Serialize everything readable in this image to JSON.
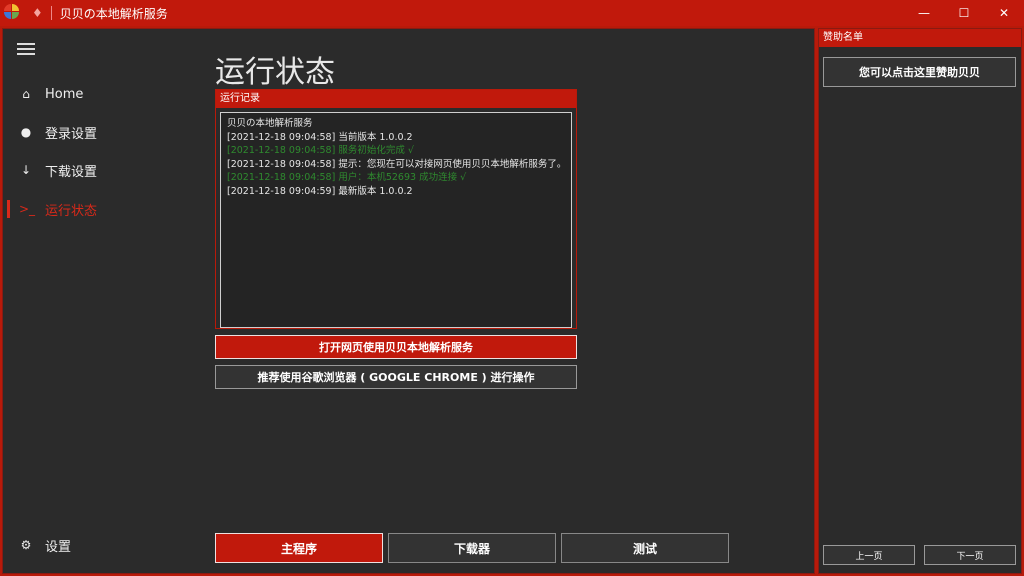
{
  "window": {
    "title": "贝贝の本地解析服务",
    "minimize": "—",
    "maximize": "☐",
    "close": "✕"
  },
  "nav": {
    "items": [
      {
        "label": "Home",
        "icon": "home-icon",
        "active": false
      },
      {
        "label": "登录设置",
        "icon": "user-icon",
        "active": false
      },
      {
        "label": "下载设置",
        "icon": "download-icon",
        "active": false
      },
      {
        "label": "运行状态",
        "icon": "terminal-icon",
        "active": true
      }
    ],
    "settings_label": "设置"
  },
  "page": {
    "title": "运行状态"
  },
  "log": {
    "header": "运行记录",
    "lines": [
      {
        "text": "贝贝の本地解析服务",
        "ok": false
      },
      {
        "text": "[2021-12-18 09:04:58] 当前版本 1.0.0.2",
        "ok": false
      },
      {
        "text": "[2021-12-18 09:04:58] 服务初始化完成 √",
        "ok": true
      },
      {
        "text": "[2021-12-18 09:04:58] 提示：您现在可以对接网页使用贝贝本地解析服务了。",
        "ok": false
      },
      {
        "text": "[2021-12-18 09:04:58] 用户：本机52693 成功连接 √",
        "ok": true
      },
      {
        "text": "[2021-12-18 09:04:59] 最新版本 1.0.0.2",
        "ok": false
      }
    ]
  },
  "actions": {
    "open_web": "打开网页使用贝贝本地解析服务",
    "recommend_chrome": "推荐使用谷歌浏览器 ( GOOGLE CHROME ) 进行操作"
  },
  "bottom_tabs": {
    "main": "主程序",
    "downloader": "下载器",
    "test": "测试"
  },
  "sponsor": {
    "header": "赞助名单",
    "button": "您可以点击这里赞助贝贝",
    "prev": "上一页",
    "next": "下一页"
  },
  "colors": {
    "accent": "#c1190c",
    "background": "#2b2b2b",
    "ok_text": "#2f8a2f"
  }
}
